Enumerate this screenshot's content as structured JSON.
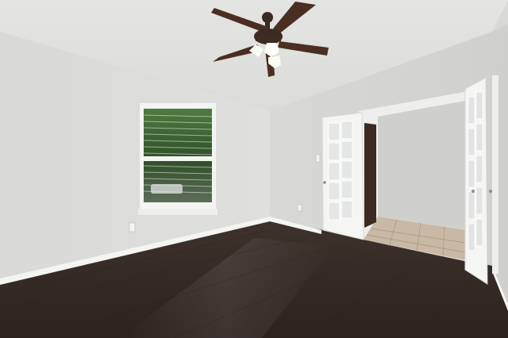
{
  "scene": {
    "description_id": "empty-room-interior",
    "colors": {
      "ceiling": "#e2e2e0",
      "wall_left": "#dcdcda",
      "wall_right": "#d4d5d3",
      "floor": "#3a2f2a",
      "trim": "#f4f4f2",
      "fan_wood": "#4a2e22",
      "fan_metal": "#3a2a22",
      "light_glass": "#fbfbf5",
      "window_green": "#3f6a36",
      "door_dark": "#3a2a22",
      "tile": "#c9b8a4"
    },
    "icons": {
      "fan": "ceiling-fan-icon",
      "window": "window-icon",
      "door": "french-door-icon",
      "outlet": "outlet-icon",
      "switch": "light-switch-icon"
    }
  }
}
